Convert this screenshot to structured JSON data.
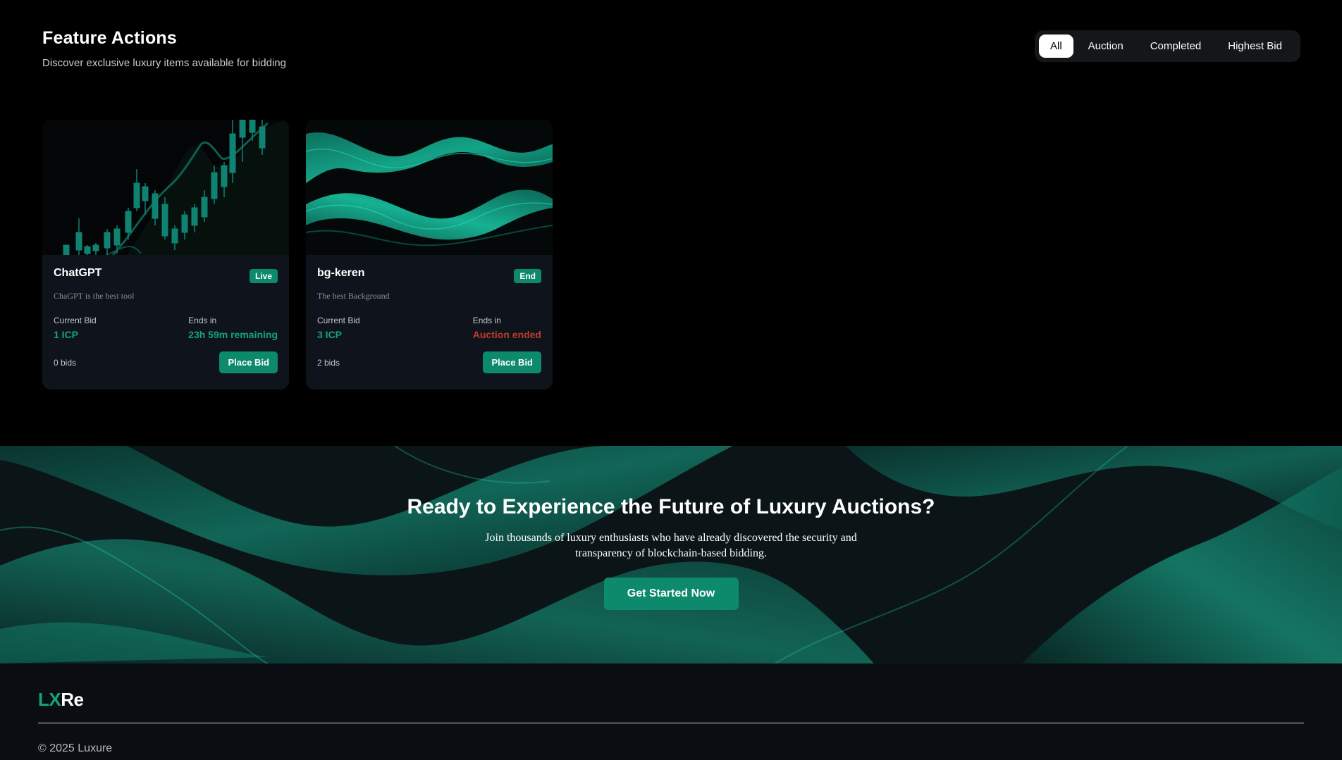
{
  "header": {
    "title": "Feature Actions",
    "subtitle": "Discover exclusive luxury items available for bidding"
  },
  "filters": [
    "All",
    "Auction",
    "Completed",
    "Highest Bid"
  ],
  "filters_active": "All",
  "cards": [
    {
      "title": "ChatGPT",
      "badge": "Live",
      "description": "ChaGPT is the best tool",
      "bid_label": "Current Bid",
      "bid_value": "1 ICP",
      "ends_label": "Ends in",
      "ends_value": "23h 59m remaining",
      "bids": "0 bids",
      "button": "Place Bid",
      "image_icon": "candlestick-chart-image"
    },
    {
      "title": "bg-keren",
      "badge": "End",
      "description": "The best Background",
      "bid_label": "Current Bid",
      "bid_value": "3 ICP",
      "ends_label": "Ends in",
      "ends_value": "Auction ended",
      "bids": "2 bids",
      "button": "Place Bid",
      "image_icon": "teal-waves-image"
    }
  ],
  "cta": {
    "title": "Ready to Experience the Future of Luxury Auctions?",
    "text": "Join thousands of luxury enthusiasts who have already discovered the security and transparency of blockchain-based bidding.",
    "button": "Get Started Now"
  },
  "footer": {
    "logo_lx": "LX",
    "logo_re": "Re",
    "copyright": "© 2025 Luxure"
  },
  "colors": {
    "accent": "#0d8a6c",
    "accent_text": "#14a37f",
    "ended": "#c0392b",
    "card_bg": "#0f141c"
  }
}
